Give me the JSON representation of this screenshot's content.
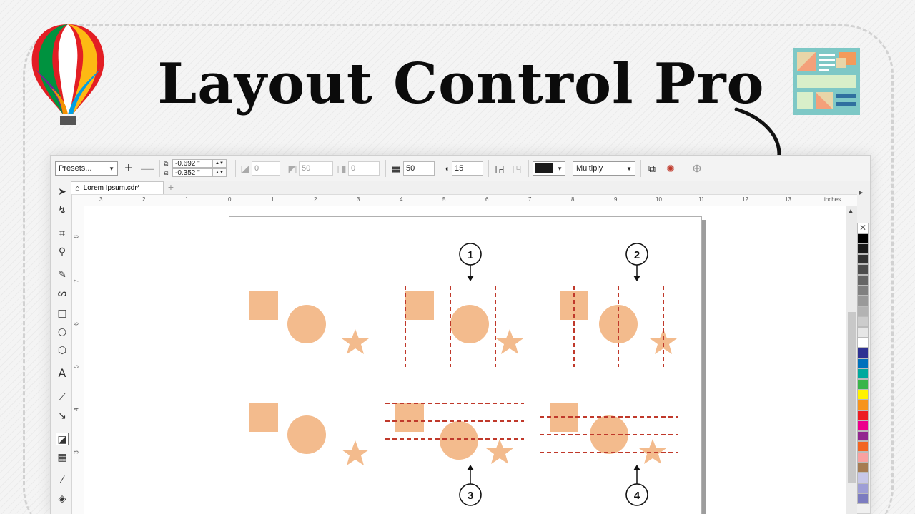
{
  "hero": {
    "title": "Layout Control Pro"
  },
  "propbar": {
    "presets_label": "Presets...",
    "pos_x": "-0.692 \"",
    "pos_y": "-0.352 \"",
    "field_1": "0",
    "field_2": "50",
    "field_3": "0",
    "transparency": "50",
    "feather": "15",
    "blend_mode": "Multiply",
    "fill_color": "#1a1a1a"
  },
  "tab": {
    "doc_name": "Lorem Ipsum.cdr*"
  },
  "ruler": {
    "labels": [
      "3",
      "2",
      "1",
      "0",
      "1",
      "2",
      "3",
      "4",
      "5",
      "6",
      "7",
      "8",
      "9",
      "10",
      "11",
      "12",
      "13"
    ],
    "unit": "inches",
    "vlabels": [
      "8",
      "7",
      "6",
      "5",
      "4",
      "3"
    ]
  },
  "callouts": [
    "1",
    "2",
    "3",
    "4"
  ],
  "colors": {
    "shape": "#f3bb8d",
    "guide": "#c0392b",
    "accent_icon": "#7ec8c6"
  },
  "palette": [
    "#000000",
    "#1a1a1a",
    "#333333",
    "#4d4d4d",
    "#666666",
    "#808080",
    "#999999",
    "#b3b3b3",
    "#cccccc",
    "#e6e6e6",
    "#ffffff",
    "#2e3192",
    "#0071bc",
    "#00a99d",
    "#39b54a",
    "#fff200",
    "#f7941d",
    "#ed1c24",
    "#ec008c",
    "#92278f",
    "#f26522",
    "#f9a1a1",
    "#a67c52",
    "#c7c7e8",
    "#9e9ed6",
    "#7c7cc0"
  ]
}
